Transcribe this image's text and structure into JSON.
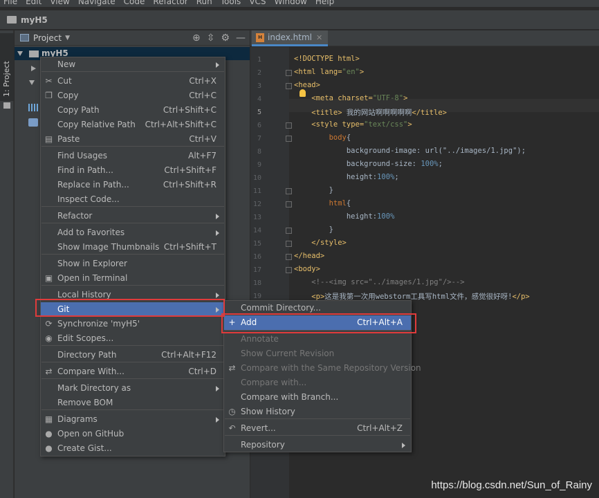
{
  "menubar": [
    "File",
    "Edit",
    "View",
    "Navigate",
    "Code",
    "Refactor",
    "Run",
    "Tools",
    "VCS",
    "Window",
    "Help"
  ],
  "navbar": {
    "project_name": "myH5"
  },
  "left_strip": {
    "tab_label": "1: Project"
  },
  "project_panel": {
    "title": "Project",
    "root_label": "myH5"
  },
  "editor": {
    "tab_name": "index.html",
    "tab_badge": "H",
    "current_line": 5,
    "lines": [
      {
        "n": "1",
        "text": "<!DOCTYPE html>"
      },
      {
        "n": "2",
        "text": "<html lang=\"en\">"
      },
      {
        "n": "3",
        "text": "<head>"
      },
      {
        "n": "4",
        "text": "    <meta charset=\"UTF-8\">"
      },
      {
        "n": "5",
        "text": "    <title> 我的网站啊啊啊啊啊</title>"
      },
      {
        "n": "6",
        "text": "    <style type=\"text/css\">"
      },
      {
        "n": "7",
        "text": "        body{"
      },
      {
        "n": "8",
        "text": "            background-image: url(\"../images/1.jpg\");"
      },
      {
        "n": "9",
        "text": "            background-size: 100%;"
      },
      {
        "n": "10",
        "text": "            height:100%;"
      },
      {
        "n": "11",
        "text": "        }"
      },
      {
        "n": "12",
        "text": "        html{"
      },
      {
        "n": "13",
        "text": "            height:100%"
      },
      {
        "n": "14",
        "text": "        }"
      },
      {
        "n": "15",
        "text": "    </style>"
      },
      {
        "n": "16",
        "text": "</head>"
      },
      {
        "n": "17",
        "text": "<body>"
      },
      {
        "n": "18",
        "text": "    <!--<img src=\"../images/1.jpg\"/>-->"
      },
      {
        "n": "19",
        "text": "    <p>这是我第一次用webstorm工具写html文件，感觉很好呀!</p>"
      }
    ]
  },
  "context_menu": {
    "items": [
      {
        "label": "New",
        "shortcut": "",
        "submenu": true,
        "icon": ""
      },
      {
        "label": "Cut",
        "shortcut": "Ctrl+X",
        "icon": "scissors-icon"
      },
      {
        "label": "Copy",
        "shortcut": "Ctrl+C",
        "icon": "copy-icon"
      },
      {
        "label": "Copy Path",
        "shortcut": "Ctrl+Shift+C"
      },
      {
        "label": "Copy Relative Path",
        "shortcut": "Ctrl+Alt+Shift+C"
      },
      {
        "label": "Paste",
        "shortcut": "Ctrl+V",
        "icon": "paste-icon"
      },
      {
        "label": "Find Usages",
        "shortcut": "Alt+F7"
      },
      {
        "label": "Find in Path...",
        "shortcut": "Ctrl+Shift+F"
      },
      {
        "label": "Replace in Path...",
        "shortcut": "Ctrl+Shift+R"
      },
      {
        "label": "Inspect Code...",
        "shortcut": ""
      },
      {
        "label": "Refactor",
        "shortcut": "",
        "submenu": true
      },
      {
        "label": "Add to Favorites",
        "shortcut": "",
        "submenu": true
      },
      {
        "label": "Show Image Thumbnails",
        "shortcut": "Ctrl+Shift+T"
      },
      {
        "label": "Show in Explorer",
        "shortcut": ""
      },
      {
        "label": "Open in Terminal",
        "shortcut": "",
        "icon": "terminal-icon"
      },
      {
        "label": "Local History",
        "shortcut": "",
        "submenu": true
      },
      {
        "label": "Git",
        "shortcut": "",
        "submenu": true,
        "highlighted": true
      },
      {
        "label": "Synchronize 'myH5'",
        "shortcut": "",
        "icon": "sync-icon"
      },
      {
        "label": "Edit Scopes...",
        "shortcut": "",
        "icon": "scope-icon"
      },
      {
        "label": "Directory Path",
        "shortcut": "Ctrl+Alt+F12"
      },
      {
        "label": "Compare With...",
        "shortcut": "Ctrl+D",
        "icon": "compare-icon"
      },
      {
        "label": "Mark Directory as",
        "shortcut": "",
        "submenu": true
      },
      {
        "label": "Remove BOM",
        "shortcut": ""
      },
      {
        "label": "Diagrams",
        "shortcut": "",
        "submenu": true,
        "icon": "diagram-icon"
      },
      {
        "label": "Open on GitHub",
        "shortcut": "",
        "icon": "github-icon"
      },
      {
        "label": "Create Gist...",
        "shortcut": "",
        "icon": "github-icon"
      }
    ]
  },
  "git_menu": {
    "items": [
      {
        "label": "Commit Directory...",
        "shortcut": ""
      },
      {
        "label": "Add",
        "shortcut": "Ctrl+Alt+A",
        "highlighted": true,
        "icon": "plus-icon"
      },
      {
        "label": "Annotate",
        "shortcut": "",
        "disabled": true
      },
      {
        "label": "Show Current Revision",
        "shortcut": "",
        "disabled": true
      },
      {
        "label": "Compare with the Same Repository Version",
        "shortcut": "",
        "disabled": true,
        "icon": "compare-icon"
      },
      {
        "label": "Compare with...",
        "shortcut": "",
        "disabled": true
      },
      {
        "label": "Compare with Branch...",
        "shortcut": ""
      },
      {
        "label": "Show History",
        "shortcut": "",
        "icon": "history-icon"
      },
      {
        "label": "Revert...",
        "shortcut": "Ctrl+Alt+Z",
        "icon": "revert-icon"
      },
      {
        "label": "Repository",
        "shortcut": "",
        "submenu": true
      }
    ]
  },
  "watermark": "https://blog.csdn.net/Sun_of_Rainy",
  "colors": {
    "highlight": "#4b6eaf",
    "annotation_box": "#e03b3b",
    "menu_bg": "#3c3f41"
  }
}
